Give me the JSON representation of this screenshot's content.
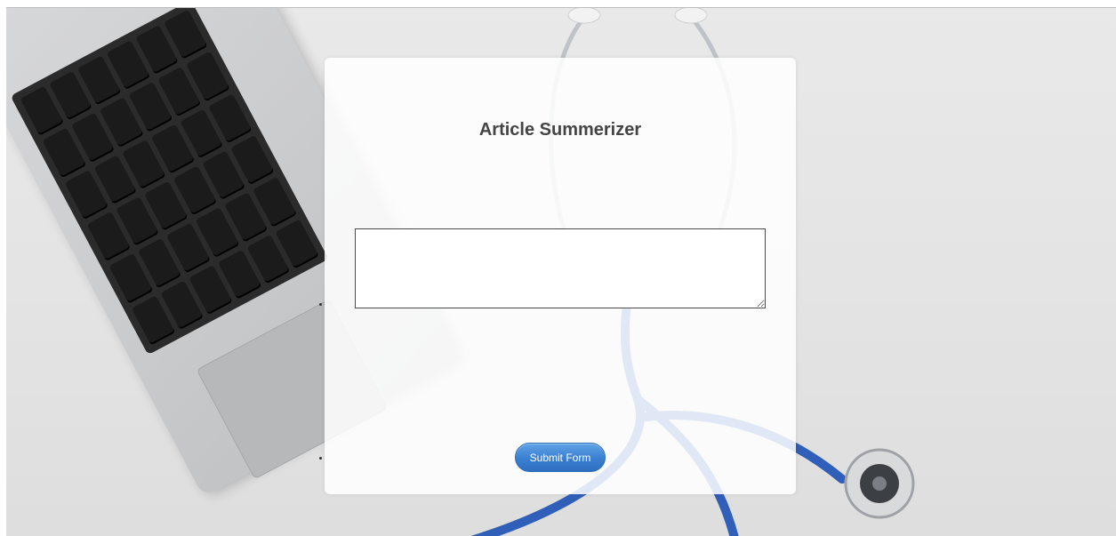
{
  "page": {
    "title": "Article Summerizer",
    "textarea": {
      "value": "",
      "placeholder": ""
    },
    "submit_label": "Submit Form"
  },
  "colors": {
    "button_start": "#5fa3e6",
    "button_end": "#2f6fc0",
    "title_text": "#444444",
    "stethoscope_tube": "#2f5fb8"
  }
}
